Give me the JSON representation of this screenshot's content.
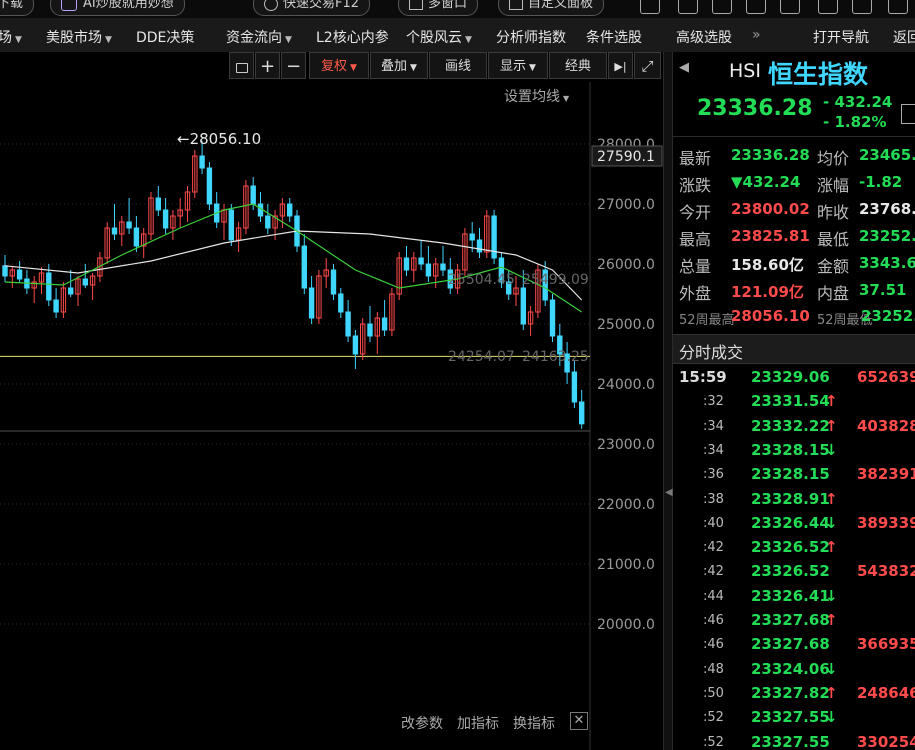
{
  "topbar": {
    "left_label": "下载",
    "ai_label": "AI炒股就用妙想",
    "quick_trade": "快速交易F12",
    "multi_window": "多窗口",
    "custom_layout": "自定义面板"
  },
  "menu": {
    "items": [
      {
        "label": "场",
        "dropdown": true
      },
      {
        "label": "美股市场",
        "dropdown": true
      },
      {
        "label": "DDE决策",
        "dropdown": false
      },
      {
        "label": "资金流向",
        "dropdown": true
      },
      {
        "label": "L2核心内参",
        "dropdown": false
      },
      {
        "label": "个股风云",
        "dropdown": true
      },
      {
        "label": "分析师指数",
        "dropdown": false
      },
      {
        "label": "条件选股",
        "dropdown": false
      },
      {
        "label": "高级选股",
        "dropdown": false
      }
    ],
    "more": "»",
    "open_nav": "打开导航",
    "back": "返回"
  },
  "chart_toolbar": {
    "lock_icon": "lock-icon",
    "zoom_in": "+",
    "zoom_out": "−",
    "adjust": "复权",
    "overlay": "叠加",
    "draw": "画线",
    "display": "显示",
    "classic": "经典",
    "play": "▶|",
    "fullscreen": "⤢"
  },
  "chart_overlay": {
    "ma_setting": "设置均线",
    "peak_label": "←28056.10",
    "current_price_tag": "27590.1",
    "ma_label_1": "25504.45",
    "ma_label_2": "25499.09",
    "hline_label_1": "24254.07",
    "hline_label_2": "24163.25",
    "bottom_change_param": "改参数",
    "bottom_add_indicator": "加指标",
    "bottom_switch_indicator": "换指标"
  },
  "chart_data": {
    "type": "candlestick",
    "y_ticks": [
      "28000.0",
      "27000.0",
      "26000.0",
      "25000.0",
      "24000.0",
      "23000.0",
      "22000.0",
      "21000.0",
      "20000.0"
    ],
    "ylim": [
      19500,
      28600
    ],
    "peak": 28056.1,
    "horizontal_line": 24460,
    "candles": [
      [
        25970,
        26150,
        25700,
        25800
      ],
      [
        25800,
        25950,
        25600,
        25900
      ],
      [
        25900,
        26050,
        25700,
        25750
      ],
      [
        25750,
        25900,
        25500,
        25600
      ],
      [
        25600,
        25800,
        25350,
        25700
      ],
      [
        25700,
        25950,
        25500,
        25850
      ],
      [
        25850,
        26000,
        25300,
        25400
      ],
      [
        25400,
        25600,
        25100,
        25200
      ],
      [
        25200,
        25700,
        25100,
        25600
      ],
      [
        25600,
        25900,
        25450,
        25500
      ],
      [
        25500,
        25800,
        25300,
        25750
      ],
      [
        25750,
        26000,
        25600,
        25650
      ],
      [
        25650,
        25850,
        25400,
        25800
      ],
      [
        25800,
        26200,
        25700,
        26100
      ],
      [
        26100,
        26700,
        26000,
        26600
      ],
      [
        26600,
        27000,
        26400,
        26500
      ],
      [
        26500,
        26800,
        26300,
        26700
      ],
      [
        26700,
        27100,
        26500,
        26600
      ],
      [
        26600,
        26800,
        26200,
        26300
      ],
      [
        26300,
        26600,
        26100,
        26500
      ],
      [
        26500,
        27200,
        26400,
        27100
      ],
      [
        27100,
        27300,
        26800,
        26900
      ],
      [
        26900,
        27100,
        26500,
        26600
      ],
      [
        26600,
        26900,
        26400,
        26800
      ],
      [
        26800,
        27100,
        26600,
        26900
      ],
      [
        26900,
        27300,
        26700,
        27200
      ],
      [
        27200,
        27900,
        27100,
        27800
      ],
      [
        27800,
        28056,
        27500,
        27600
      ],
      [
        27600,
        27700,
        26900,
        27000
      ],
      [
        27000,
        27200,
        26600,
        26700
      ],
      [
        26700,
        27000,
        26400,
        26900
      ],
      [
        26900,
        27000,
        26300,
        26400
      ],
      [
        26400,
        26700,
        26200,
        26600
      ],
      [
        26600,
        27400,
        26500,
        27300
      ],
      [
        27300,
        27450,
        26900,
        27000
      ],
      [
        27000,
        27200,
        26700,
        26800
      ],
      [
        26800,
        27000,
        26500,
        26600
      ],
      [
        26600,
        26900,
        26400,
        26800
      ],
      [
        26800,
        27100,
        26600,
        27000
      ],
      [
        27000,
        27100,
        26700,
        26800
      ],
      [
        26800,
        26900,
        26200,
        26300
      ],
      [
        26300,
        26500,
        25500,
        25600
      ],
      [
        25600,
        25800,
        25000,
        25100
      ],
      [
        25100,
        25900,
        25000,
        25800
      ],
      [
        25800,
        26100,
        25600,
        25900
      ],
      [
        25900,
        26000,
        25400,
        25500
      ],
      [
        25500,
        25600,
        25100,
        25200
      ],
      [
        25200,
        25400,
        24700,
        24800
      ],
      [
        24800,
        24900,
        24250,
        24500
      ],
      [
        24500,
        25100,
        24400,
        25000
      ],
      [
        25000,
        25300,
        24700,
        24800
      ],
      [
        24800,
        25200,
        24500,
        25100
      ],
      [
        25100,
        25400,
        24800,
        24900
      ],
      [
        24900,
        25600,
        24800,
        25500
      ],
      [
        25500,
        26200,
        25400,
        26100
      ],
      [
        26100,
        26300,
        25800,
        25900
      ],
      [
        25900,
        26200,
        25700,
        26100
      ],
      [
        26100,
        26400,
        25900,
        26000
      ],
      [
        26000,
        26300,
        25700,
        25800
      ],
      [
        25800,
        26100,
        25600,
        26000
      ],
      [
        26000,
        26300,
        25800,
        25900
      ],
      [
        25900,
        26100,
        25500,
        25600
      ],
      [
        25600,
        26000,
        25500,
        25900
      ],
      [
        25900,
        26600,
        25800,
        26500
      ],
      [
        26500,
        26700,
        26200,
        26400
      ],
      [
        26400,
        26600,
        26100,
        26200
      ],
      [
        26200,
        26900,
        26100,
        26800
      ],
      [
        26800,
        26900,
        26000,
        26100
      ],
      [
        26100,
        26200,
        25600,
        25700
      ],
      [
        25700,
        25900,
        25400,
        25500
      ],
      [
        25500,
        25800,
        25300,
        25600
      ],
      [
        25600,
        25900,
        24900,
        25000
      ],
      [
        25000,
        25300,
        24800,
        25200
      ],
      [
        25200,
        26000,
        25100,
        25900
      ],
      [
        25900,
        26050,
        25300,
        25400
      ],
      [
        25400,
        25500,
        24700,
        24800
      ],
      [
        24800,
        25000,
        24300,
        24500
      ],
      [
        24500,
        24700,
        24000,
        24200
      ],
      [
        24200,
        24400,
        23600,
        23700
      ],
      [
        23700,
        23900,
        23252,
        23336
      ]
    ],
    "ma_white": [
      [
        0,
        25970
      ],
      [
        10,
        25850
      ],
      [
        20,
        26050
      ],
      [
        30,
        26350
      ],
      [
        40,
        26550
      ],
      [
        50,
        26500
      ],
      [
        60,
        26350
      ],
      [
        70,
        26150
      ],
      [
        75,
        25900
      ],
      [
        79,
        25400
      ]
    ],
    "ma_green": [
      [
        0,
        25700
      ],
      [
        8,
        25650
      ],
      [
        16,
        26150
      ],
      [
        24,
        26600
      ],
      [
        30,
        26900
      ],
      [
        34,
        27000
      ],
      [
        40,
        26550
      ],
      [
        48,
        25900
      ],
      [
        54,
        25600
      ],
      [
        62,
        25750
      ],
      [
        68,
        25950
      ],
      [
        74,
        25600
      ],
      [
        79,
        25200
      ]
    ]
  },
  "quote": {
    "code": "HSI",
    "name": "恒生指数",
    "price": "23336.28",
    "change": "- 432.24",
    "change_pct": "- 1.82%",
    "rows": [
      {
        "l1": "最新",
        "v1": "23336.28",
        "c1": "green",
        "l2": "均价",
        "v2": "23465.",
        "c2": "green"
      },
      {
        "l1": "涨跌",
        "v1": "▼432.24",
        "c1": "green",
        "l2": "涨幅",
        "v2": "-1.82",
        "c2": "green"
      },
      {
        "l1": "今开",
        "v1": "23800.02",
        "c1": "red",
        "l2": "昨收",
        "v2": "23768.",
        "c2": "white"
      },
      {
        "l1": "最高",
        "v1": "23825.81",
        "c1": "red",
        "l2": "最低",
        "v2": "23252.",
        "c2": "green"
      },
      {
        "l1": "总量",
        "v1": "158.60亿",
        "c1": "white",
        "l2": "金额",
        "v2": "3343.61",
        "c2": "green"
      },
      {
        "l1": "外盘",
        "v1": "121.09亿",
        "c1": "red",
        "l2": "内盘",
        "v2": "37.51",
        "c2": "green"
      }
    ],
    "w52_high_label": "52周最高",
    "w52_high": "28056.10",
    "w52_low_label": "52周最低",
    "w52_low": "23252."
  },
  "ticks": {
    "title": "分时成交",
    "rows": [
      {
        "time": "15:59",
        "price": "23329.06",
        "dir": "",
        "vol": "652639"
      },
      {
        "time": ":32",
        "price": "23331.54",
        "dir": "up",
        "vol": ""
      },
      {
        "time": ":34",
        "price": "23332.22",
        "dir": "up",
        "vol": "403828"
      },
      {
        "time": ":34",
        "price": "23328.15",
        "dir": "down",
        "vol": ""
      },
      {
        "time": ":36",
        "price": "23328.15",
        "dir": "",
        "vol": "382391"
      },
      {
        "time": ":38",
        "price": "23328.91",
        "dir": "up",
        "vol": ""
      },
      {
        "time": ":40",
        "price": "23326.44",
        "dir": "down",
        "vol": "389339"
      },
      {
        "time": ":42",
        "price": "23326.52",
        "dir": "up",
        "vol": ""
      },
      {
        "time": ":42",
        "price": "23326.52",
        "dir": "",
        "vol": "543832"
      },
      {
        "time": ":44",
        "price": "23326.41",
        "dir": "down",
        "vol": ""
      },
      {
        "time": ":46",
        "price": "23327.68",
        "dir": "up",
        "vol": ""
      },
      {
        "time": ":46",
        "price": "23327.68",
        "dir": "",
        "vol": "366935"
      },
      {
        "time": ":48",
        "price": "23324.06",
        "dir": "down",
        "vol": ""
      },
      {
        "time": ":50",
        "price": "23327.82",
        "dir": "up",
        "vol": "248646"
      },
      {
        "time": ":52",
        "price": "23327.55",
        "dir": "down",
        "vol": ""
      },
      {
        "time": ":52",
        "price": "23327.55",
        "dir": "",
        "vol": "330254"
      }
    ]
  },
  "colors": {
    "up": "#ff4b4b",
    "down": "#22dd55",
    "candle_down": "#3fd6ff",
    "accent_cyan": "#3fd6ff"
  }
}
